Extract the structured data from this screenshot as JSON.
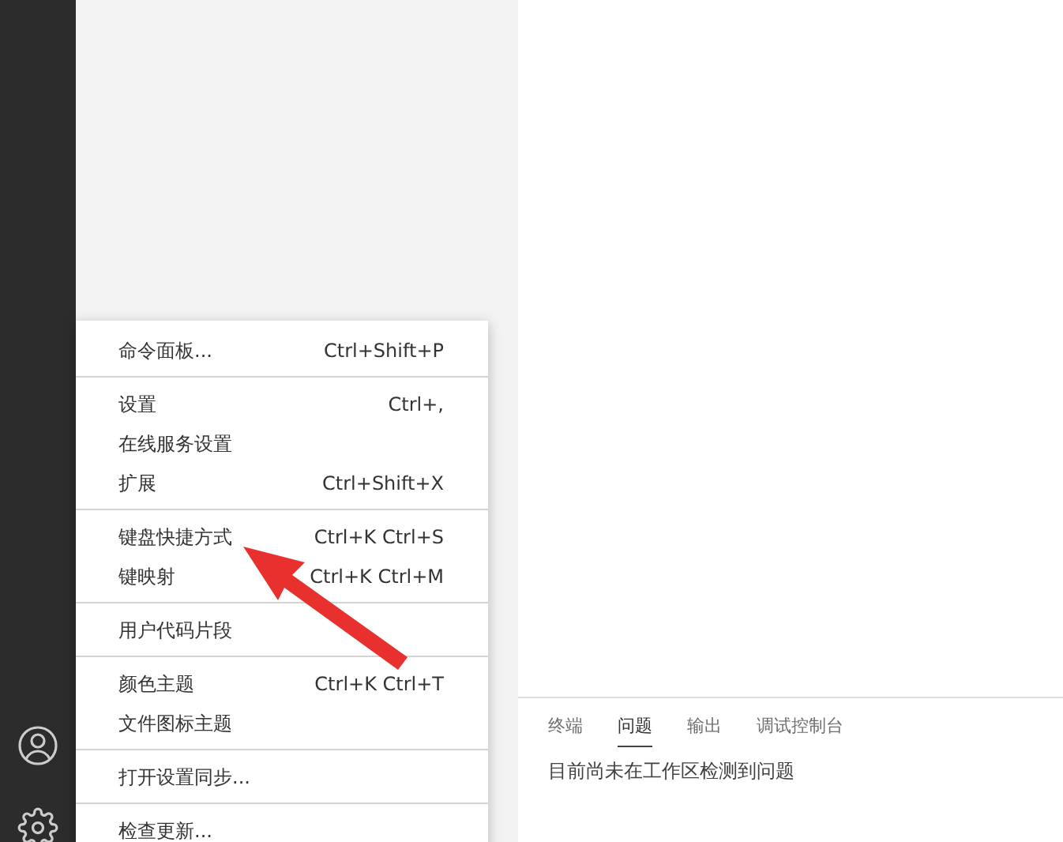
{
  "menu": {
    "groups": [
      [
        {
          "label": "命令面板...",
          "shortcut": "Ctrl+Shift+P"
        }
      ],
      [
        {
          "label": "设置",
          "shortcut": "Ctrl+,"
        },
        {
          "label": "在线服务设置"
        },
        {
          "label": "扩展",
          "shortcut": "Ctrl+Shift+X"
        }
      ],
      [
        {
          "label": "键盘快捷方式",
          "shortcut": "Ctrl+K Ctrl+S"
        },
        {
          "label": "键映射",
          "shortcut": "Ctrl+K Ctrl+M"
        }
      ],
      [
        {
          "label": "用户代码片段"
        }
      ],
      [
        {
          "label": "颜色主题",
          "shortcut": "Ctrl+K Ctrl+T"
        },
        {
          "label": "文件图标主题"
        }
      ],
      [
        {
          "label": "打开设置同步..."
        }
      ],
      [
        {
          "label": "检查更新..."
        }
      ]
    ]
  },
  "panel": {
    "tabs": [
      {
        "label": "终端",
        "selected": false
      },
      {
        "label": "问题",
        "selected": true
      },
      {
        "label": "输出",
        "selected": false
      },
      {
        "label": "调试控制台",
        "selected": false
      }
    ],
    "message": "目前尚未在工作区检测到问题"
  }
}
